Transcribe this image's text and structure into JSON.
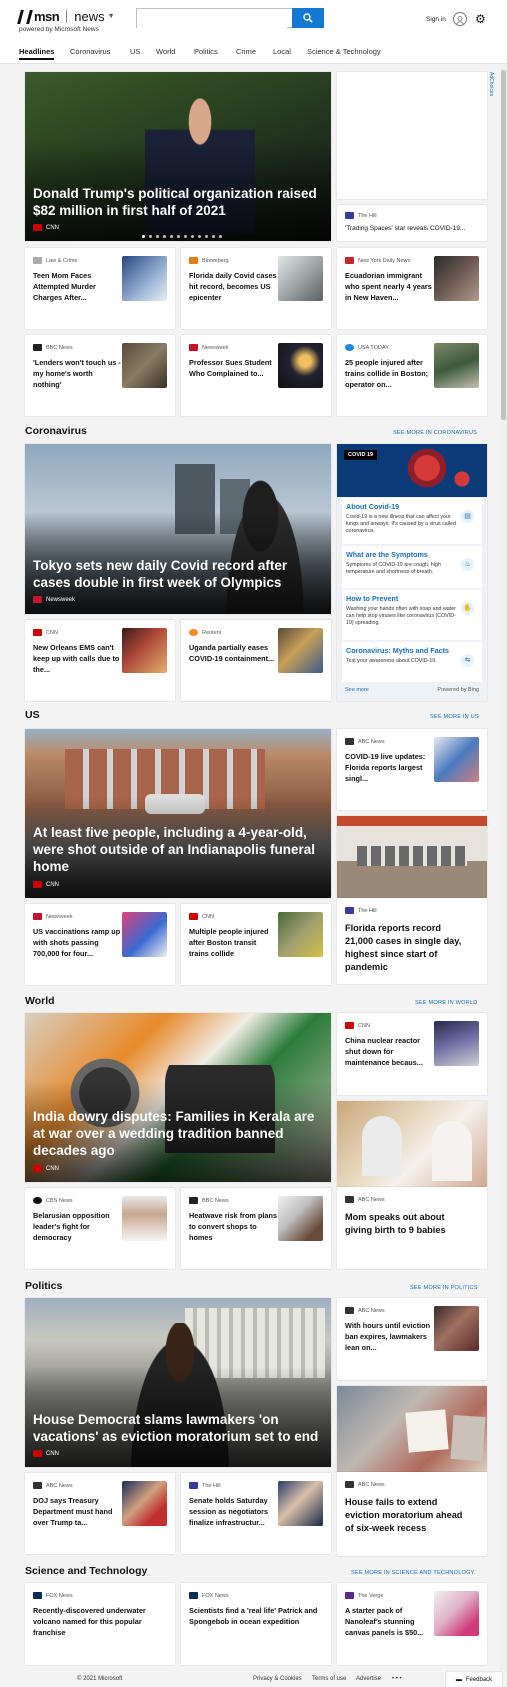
{
  "header": {
    "brand": "msn",
    "section": "news",
    "powered_by": "powered by Microsoft News",
    "search_placeholder": "",
    "signin": "Sign in"
  },
  "nav": [
    "Headlines",
    "Coronavirus",
    "US",
    "World",
    "Politics",
    "Crime",
    "Local",
    "Science & Technology"
  ],
  "top": {
    "hero": {
      "title": "Donald Trump's political organization raised $82 million in first half of 2021",
      "source": "CNN"
    },
    "ad_label": "AdChoices",
    "side": {
      "source": "The Hill",
      "title": "'Trading Spaces' star reveals COVID-19..."
    },
    "cards": [
      {
        "source": "Law & Crime",
        "title": "Teen Mom Faces Attempted Murder Charges After..."
      },
      {
        "source": "Bloomberg",
        "title": "Florida daily Covid cases hit record, becomes US epicenter"
      },
      {
        "source": "New York Daily News",
        "title": "Ecuadorian immigrant who spent nearly 4 years in New Haven..."
      },
      {
        "source": "BBC News",
        "title": "'Lenders won't touch us - my home's worth nothing'"
      },
      {
        "source": "Newsweek",
        "title": "Professor Sues Student Who Complained to..."
      },
      {
        "source": "USA TODAY",
        "title": "25 people injured after trains collide in Boston; operator on..."
      }
    ]
  },
  "coronavirus": {
    "title": "Coronavirus",
    "see_more": "SEE MORE IN CORONAVIRUS",
    "hero": {
      "title": "Tokyo sets new daily Covid record after cases double in first week of Olympics",
      "source": "Newsweek"
    },
    "cards": [
      {
        "source": "CNN",
        "title": "New Orleans EMS can't keep up with calls due to the..."
      },
      {
        "source": "Reuters",
        "title": "Uganda partially eases COVID-19 containment..."
      }
    ],
    "panel": {
      "badge": "COVID 19",
      "items": [
        {
          "title": "About Covid-19",
          "desc": "Covid-19 is a new illness that can affect your lungs and airways. It's caused by a virus called coronavirus."
        },
        {
          "title": "What are the Symptoms",
          "desc": "Symptoms of COVID-19 are cough, high temperature and shortness of breath."
        },
        {
          "title": "How to Prevent",
          "desc": "Washing your hands often with soap and water can help stop viruses like coronavirus (COVID-19) spreading."
        },
        {
          "title": "Coronavirus: Myths and Facts",
          "desc": "Test your awareness about COVID-19."
        }
      ],
      "see_more": "See more",
      "powered": "Powered by Bing"
    }
  },
  "us": {
    "title": "US",
    "see_more": "SEE MORE IN US",
    "hero": {
      "title": "At least five people, including a 4-year-old, were shot outside of an Indianapolis funeral home",
      "source": "CNN"
    },
    "side_top": {
      "source": "ABC News",
      "title": "COVID-19 live updates: Florida reports largest singl..."
    },
    "side_wide": {
      "source": "The Hill",
      "title": "Florida reports record 21,000 cases in single day, highest since start of pandemic"
    },
    "cards": [
      {
        "source": "Newsweek",
        "title": "US vaccinations ramp up with shots passing 700,000 for four..."
      },
      {
        "source": "CNN",
        "title": "Multiple people injured after Boston transit trains collide"
      }
    ]
  },
  "world": {
    "title": "World",
    "see_more": "SEE MORE IN WORLD",
    "hero": {
      "title": "India dowry disputes: Families in Kerala are at war over a wedding tradition banned decades ago",
      "source": "CNN"
    },
    "side_top": {
      "source": "CNN",
      "title": "China nuclear reactor shut down for maintenance becaus..."
    },
    "side_wide": {
      "source": "ABC News",
      "title": "Mom speaks out about giving birth to 9 babies"
    },
    "cards": [
      {
        "source": "CBS News",
        "title": "Belarusian opposition leader's fight for democracy"
      },
      {
        "source": "BBC News",
        "title": "Heatwave risk from plans to convert shops to homes"
      }
    ]
  },
  "politics": {
    "title": "Politics",
    "see_more": "SEE MORE IN POLITICS",
    "hero": {
      "title": "House Democrat slams lawmakers 'on vacations' as eviction moratorium set to end",
      "source": "CNN"
    },
    "side_top": {
      "source": "ABC News",
      "title": "With hours until eviction ban expires, lawmakers lean on..."
    },
    "side_wide": {
      "source": "ABC News",
      "title": "House fails to extend eviction moratorium ahead of six-week recess"
    },
    "cards": [
      {
        "source": "ABC News",
        "title": "DOJ says Treasury Department must hand over Trump ta..."
      },
      {
        "source": "The Hill",
        "title": "Senate holds Saturday session as negotiators finalize infrastructur..."
      }
    ]
  },
  "scitech": {
    "title": "Science and Technology",
    "see_more": "SEE MORE IN SCIENCE AND TECHNOLOGY",
    "cards": [
      {
        "source": "FOX News",
        "title": "Recently-discovered underwater volcano named for this popular franchise"
      },
      {
        "source": "FOX News",
        "title": "Scientists find a 'real life' Patrick and Spongebob in ocean expedition"
      },
      {
        "source": "The Verge",
        "title": "A starter pack of Nanoleaf's stunning canvas panels is $50..."
      }
    ]
  },
  "footer": {
    "copyright": "© 2021 Microsoft",
    "links": [
      "Privacy & Cookies",
      "Terms of use",
      "Advertise"
    ],
    "more": "• • •",
    "feedback": "Feedback"
  },
  "colors": {
    "accent": "#1378d2",
    "link": "#1b6ec2",
    "background": "#f3f3f3"
  }
}
